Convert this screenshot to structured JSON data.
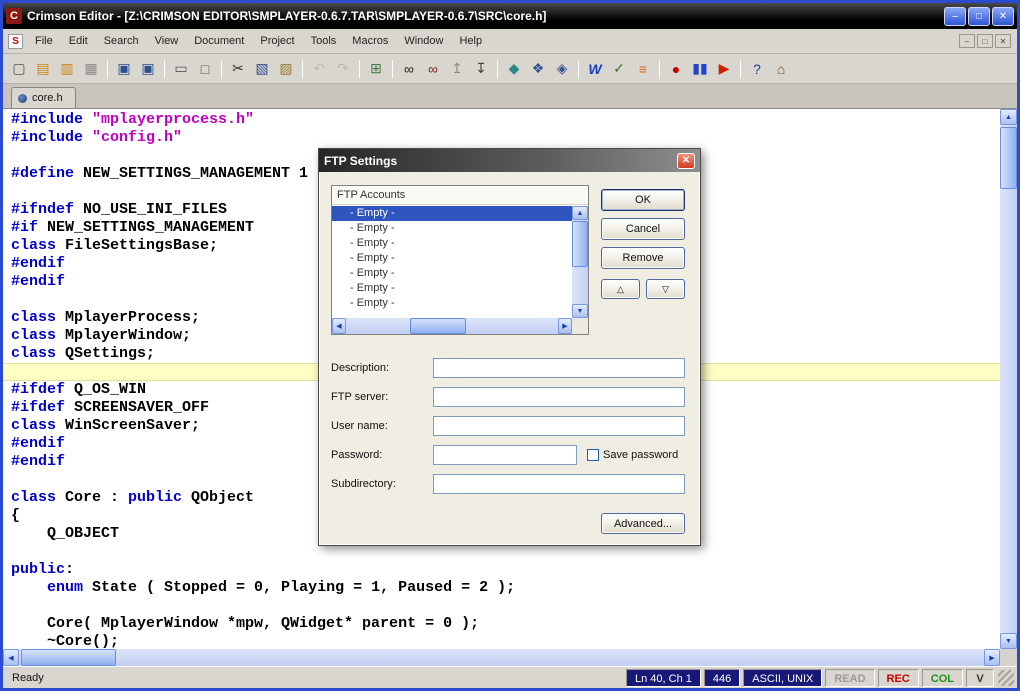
{
  "colors": {
    "keyword": "#0000cd",
    "string": "#c000c0",
    "selection": "#2f55be",
    "highlight_line": "#ffffc4",
    "titlebar": "#000000",
    "scrollbar_thumb": "#8fb0ee",
    "record_red": "#cc0000",
    "col_green": "#1f8f1f"
  },
  "window": {
    "title": "Crimson Editor - [Z:\\CRIMSON EDITOR\\SMPLAYER-0.6.7.TAR\\SMPLAYER-0.6.7\\SRC\\core.h]",
    "controls": {
      "minimize": "–",
      "maximize": "□",
      "close": "✕"
    }
  },
  "menu": {
    "items": [
      "File",
      "Edit",
      "Search",
      "View",
      "Document",
      "Project",
      "Tools",
      "Macros",
      "Window",
      "Help"
    ]
  },
  "toolbar": {
    "icons": [
      {
        "name": "new-document-button",
        "glyph": "▢",
        "color": "#555555"
      },
      {
        "name": "open-file-button",
        "glyph": "▤",
        "color": "#c8871e"
      },
      {
        "name": "open-remote-button",
        "glyph": "▥",
        "color": "#c8871e"
      },
      {
        "name": "close-file-button",
        "glyph": "▦",
        "color": "#8a8a8a",
        "sep": true
      },
      {
        "name": "save-button",
        "glyph": "▣",
        "color": "#2c4f8f"
      },
      {
        "name": "save-all-button",
        "glyph": "▣",
        "color": "#2c4f8f",
        "sep": true
      },
      {
        "name": "print-button",
        "glyph": "▭",
        "color": "#555555"
      },
      {
        "name": "print-preview-button",
        "glyph": "□",
        "color": "#555555",
        "sep": true
      },
      {
        "name": "cut-button",
        "glyph": "✂",
        "color": "#333333"
      },
      {
        "name": "copy-button",
        "glyph": "▧",
        "color": "#33518f"
      },
      {
        "name": "paste-button",
        "glyph": "▨",
        "color": "#9a7d2e",
        "sep": true
      },
      {
        "name": "undo-button",
        "glyph": "↶",
        "color": "#9a9a9a",
        "disabled": true
      },
      {
        "name": "redo-button",
        "glyph": "↷",
        "color": "#9a9a9a",
        "disabled": true,
        "sep": true
      },
      {
        "name": "properties-grid-button",
        "glyph": "⊞",
        "color": "#4a7a4a",
        "sep": true
      },
      {
        "name": "find-button",
        "glyph": "∞",
        "color": "#222222"
      },
      {
        "name": "find-in-files-button",
        "glyph": "∞",
        "color": "#7a1f1f"
      },
      {
        "name": "find-previous-button",
        "glyph": "↥",
        "color": "#8a8a8a"
      },
      {
        "name": "find-next-button",
        "glyph": "↧",
        "color": "#444444",
        "sep": true
      },
      {
        "name": "toggle-bookmark-button",
        "glyph": "◆",
        "color": "#2a8a8a"
      },
      {
        "name": "window-list-button",
        "glyph": "❖",
        "color": "#33518f"
      },
      {
        "name": "preview-in-browser-button",
        "glyph": "◈",
        "color": "#33518f",
        "sep": true
      },
      {
        "name": "word-wrap-button",
        "glyph": "W",
        "color": "#1a3fbf",
        "italic": true
      },
      {
        "name": "spell-check-button",
        "glyph": "✓",
        "color": "#2a7a2a"
      },
      {
        "name": "sort-lines-button",
        "glyph": "≡",
        "color": "#d4691e",
        "sep": true
      },
      {
        "name": "record-macro-button",
        "glyph": "●",
        "color": "#cc0000"
      },
      {
        "name": "pause-macro-button",
        "glyph": "▮▮",
        "color": "#2244cc"
      },
      {
        "name": "play-macro-button",
        "glyph": "▶",
        "color": "#cc2200",
        "sep": true
      },
      {
        "name": "help-button",
        "glyph": "?",
        "color": "#223a8f"
      },
      {
        "name": "home-button",
        "glyph": "⌂",
        "color": "#7a4a1e"
      }
    ]
  },
  "tab_bar": {
    "tabs": [
      {
        "label": "core.h"
      }
    ]
  },
  "editor": {
    "lines": [
      {
        "segs": [
          {
            "c": "k",
            "t": "#include "
          },
          {
            "c": "s",
            "t": "\"mplayerprocess.h\""
          }
        ]
      },
      {
        "segs": [
          {
            "c": "k",
            "t": "#include "
          },
          {
            "c": "s",
            "t": "\"config.h\""
          }
        ]
      },
      {
        "segs": []
      },
      {
        "segs": [
          {
            "c": "k",
            "t": "#define "
          },
          {
            "c": "p",
            "t": "NEW_SETTINGS_MANAGEMENT 1"
          }
        ]
      },
      {
        "segs": []
      },
      {
        "segs": [
          {
            "c": "k",
            "t": "#ifndef "
          },
          {
            "c": "p",
            "t": "NO_USE_INI_FILES"
          }
        ]
      },
      {
        "segs": [
          {
            "c": "k",
            "t": "#if "
          },
          {
            "c": "p",
            "t": "NEW_SETTINGS_MANAGEMENT"
          }
        ]
      },
      {
        "segs": [
          {
            "c": "k",
            "t": "class "
          },
          {
            "c": "p",
            "t": "FileSettingsBase;"
          }
        ]
      },
      {
        "segs": [
          {
            "c": "k",
            "t": "#endif"
          }
        ]
      },
      {
        "segs": [
          {
            "c": "k",
            "t": "#endif"
          }
        ]
      },
      {
        "segs": []
      },
      {
        "segs": [
          {
            "c": "k",
            "t": "class "
          },
          {
            "c": "p",
            "t": "MplayerProcess;"
          }
        ]
      },
      {
        "segs": [
          {
            "c": "k",
            "t": "class "
          },
          {
            "c": "p",
            "t": "MplayerWindow;"
          }
        ]
      },
      {
        "segs": [
          {
            "c": "k",
            "t": "class "
          },
          {
            "c": "p",
            "t": "QSettings;"
          }
        ]
      },
      {
        "hl": true,
        "segs": []
      },
      {
        "segs": [
          {
            "c": "k",
            "t": "#ifdef "
          },
          {
            "c": "p",
            "t": "Q_OS_WIN"
          }
        ]
      },
      {
        "segs": [
          {
            "c": "k",
            "t": "#ifdef "
          },
          {
            "c": "p",
            "t": "SCREENSAVER_OFF"
          }
        ]
      },
      {
        "segs": [
          {
            "c": "k",
            "t": "class "
          },
          {
            "c": "p",
            "t": "WinScreenSaver;"
          }
        ]
      },
      {
        "segs": [
          {
            "c": "k",
            "t": "#endif"
          }
        ]
      },
      {
        "segs": [
          {
            "c": "k",
            "t": "#endif"
          }
        ]
      },
      {
        "segs": []
      },
      {
        "segs": [
          {
            "c": "k",
            "t": "class "
          },
          {
            "c": "p",
            "t": "Core : "
          },
          {
            "c": "k",
            "t": "public "
          },
          {
            "c": "p",
            "t": "QObject"
          }
        ]
      },
      {
        "segs": [
          {
            "c": "p",
            "t": "{"
          }
        ]
      },
      {
        "segs": [
          {
            "c": "p",
            "t": "    Q_OBJECT"
          }
        ]
      },
      {
        "segs": []
      },
      {
        "segs": [
          {
            "c": "k",
            "t": "public"
          },
          {
            "c": "p",
            "t": ":"
          }
        ]
      },
      {
        "segs": [
          {
            "c": "p",
            "t": "    "
          },
          {
            "c": "k",
            "t": "enum "
          },
          {
            "c": "p",
            "t": "State ( Stopped = 0, Playing = 1, Paused = 2 );"
          }
        ]
      },
      {
        "segs": []
      },
      {
        "segs": [
          {
            "c": "p",
            "t": "    Core( MplayerWindow *mpw, QWidget* parent = 0 );"
          }
        ]
      },
      {
        "segs": [
          {
            "c": "p",
            "t": "    ~Core();"
          }
        ]
      }
    ]
  },
  "dialog": {
    "title": "FTP Settings",
    "close_glyph": "✕",
    "list": {
      "header": "FTP Accounts",
      "items": [
        "- Empty -",
        "- Empty -",
        "- Empty -",
        "- Empty -",
        "- Empty -",
        "- Empty -",
        "- Empty -"
      ],
      "selected_index": 0
    },
    "buttons": {
      "ok": "OK",
      "cancel": "Cancel",
      "remove": "Remove",
      "move_up": "△",
      "move_down": "▽",
      "advanced": "Advanced..."
    },
    "fields": [
      {
        "name": "description",
        "label": "Description:",
        "value": ""
      },
      {
        "name": "ftp-server",
        "label": "FTP server:",
        "value": ""
      },
      {
        "name": "user-name",
        "label": "User name:",
        "value": ""
      },
      {
        "name": "password",
        "label": "Password:",
        "value": "",
        "checkbox": "Save password"
      },
      {
        "name": "subdirectory",
        "label": "Subdirectory:",
        "value": ""
      }
    ]
  },
  "status_bar": {
    "message": "Ready",
    "cursor": "Ln 40, Ch 1",
    "file_size": "446",
    "encoding": "ASCII, UNIX",
    "indicators": [
      {
        "label": "READ",
        "color": "#9a9a9a"
      },
      {
        "label": "REC",
        "color": "#cc0000"
      },
      {
        "label": "COL",
        "color": "#1f8f1f"
      },
      {
        "label": "V",
        "color": "#333333"
      }
    ]
  }
}
